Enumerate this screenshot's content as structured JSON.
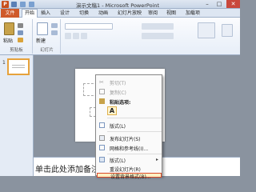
{
  "window": {
    "title": "演示文稿1 - Microsoft PowerPoint",
    "logo": "P",
    "controls": {
      "minimize": "–",
      "maximize": "□",
      "close": "✕"
    }
  },
  "tabs": {
    "file": "文件",
    "home": "开始",
    "insert": "插入",
    "design": "设计",
    "transitions": "切换",
    "animations": "动画",
    "slideshow": "幻灯片放映",
    "review": "审阅",
    "view": "视图",
    "addins": "加载项"
  },
  "ribbon": {
    "clipboard": {
      "label": "剪贴板",
      "paste": "粘贴"
    },
    "slides": {
      "label": "幻灯片",
      "new_slide": "新建"
    }
  },
  "left_panel": {
    "slide_number": "1"
  },
  "notes": {
    "placeholder": "单击此处添加备注"
  },
  "context_menu": {
    "items": [
      {
        "label": "剪切(T)",
        "disabled": true
      },
      {
        "label": "复制(C)",
        "disabled": true
      },
      {
        "label": "粘贴选项:",
        "bold": true
      },
      {
        "label": "A"
      },
      {
        "label": "版式(L)"
      },
      {
        "label": "发布幻灯片(S)"
      },
      {
        "label": "网格和参考线(I)..."
      },
      {
        "label": "版式(L)"
      },
      {
        "label": "重设幻灯片(R)"
      },
      {
        "label": "设置背景格式(B)..."
      }
    ]
  },
  "colors": {
    "file_tab": "#cf5a2b",
    "highlight_border": "#d94a2a",
    "highlight_fill": "#fdf0c4"
  }
}
